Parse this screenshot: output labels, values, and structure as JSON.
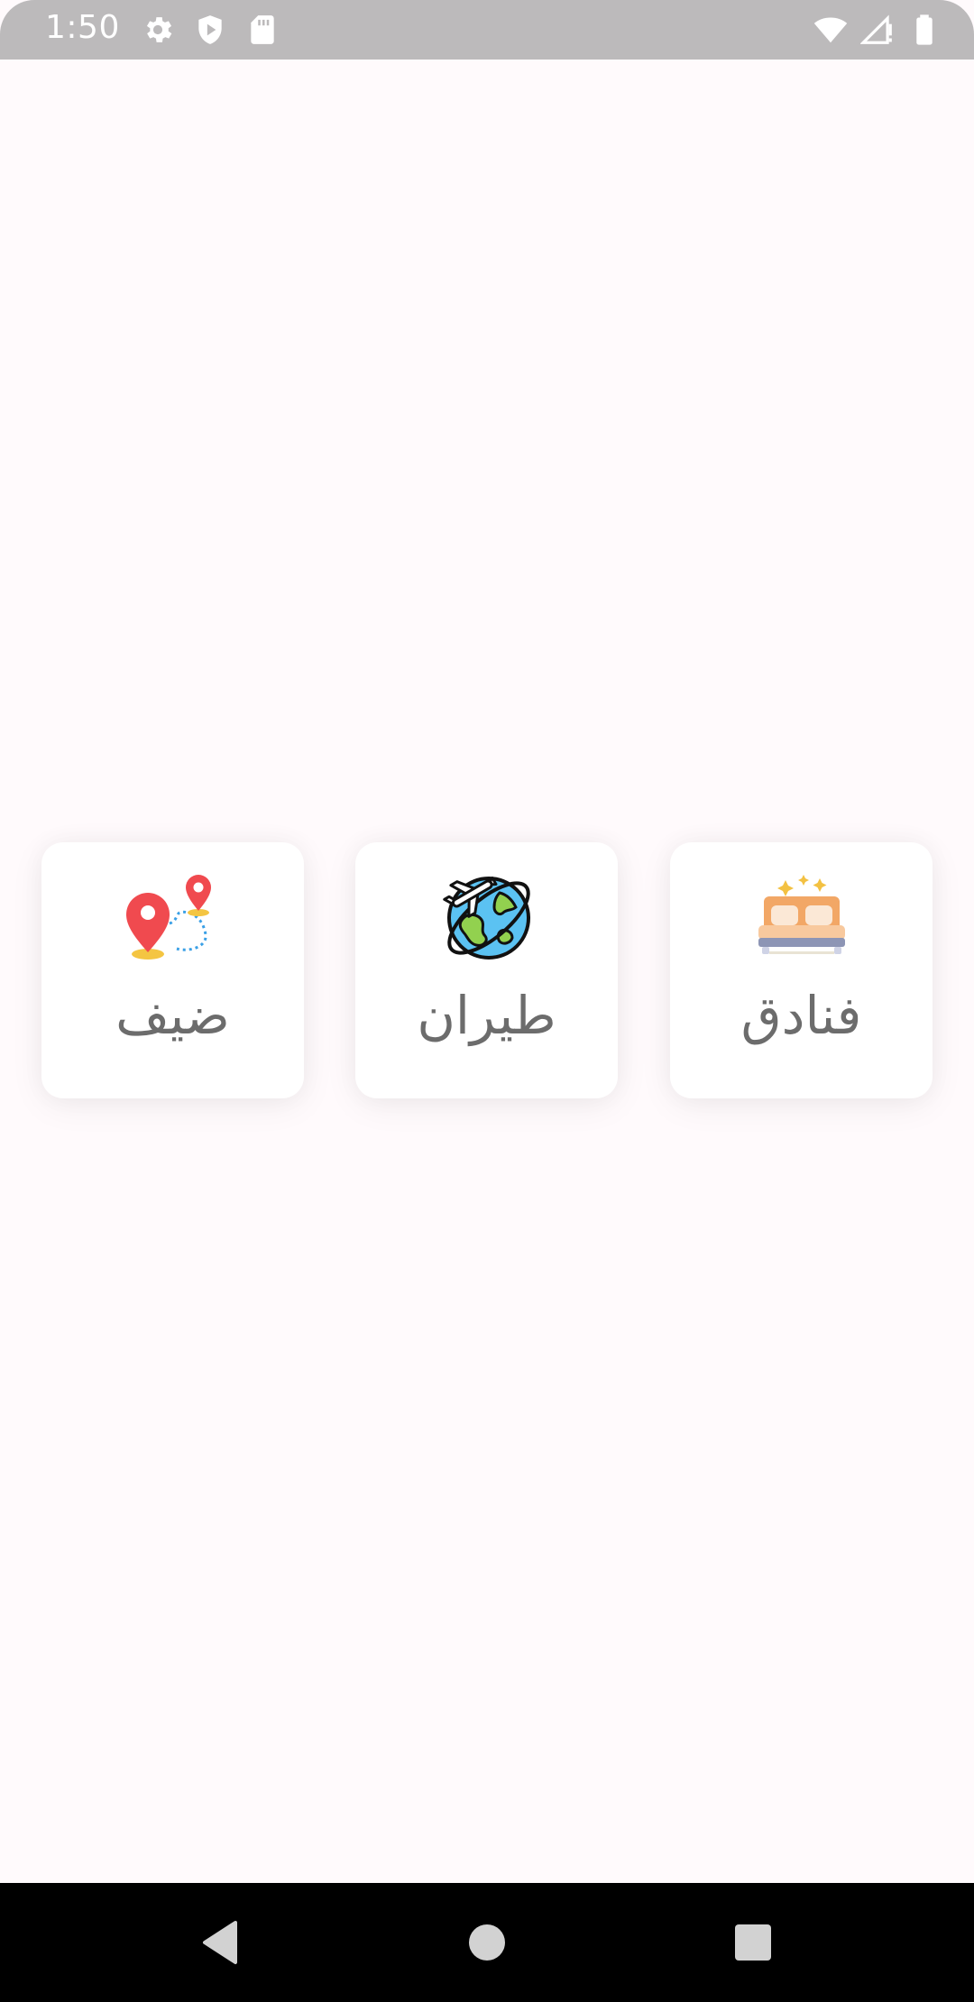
{
  "status_bar": {
    "time": "1:50",
    "left_icons": [
      "settings-icon",
      "shield-icon",
      "sd-card-icon"
    ],
    "right_icons": [
      "wifi-icon",
      "signal-icon",
      "battery-icon"
    ]
  },
  "categories": [
    {
      "label": "فنادق",
      "icon": "hotel-bed-icon"
    },
    {
      "label": "طيران",
      "icon": "globe-airplane-icon"
    },
    {
      "label": "ضيف",
      "icon": "map-pins-route-icon"
    }
  ],
  "nav_bar": {
    "buttons": [
      "back-icon",
      "home-icon",
      "recents-icon"
    ]
  },
  "colors": {
    "status_bar_bg": "#bcbabb",
    "page_bg": "#fffafc",
    "card_bg": "#ffffff",
    "label_text": "#6c6c6c",
    "nav_bar_bg": "#000000"
  }
}
